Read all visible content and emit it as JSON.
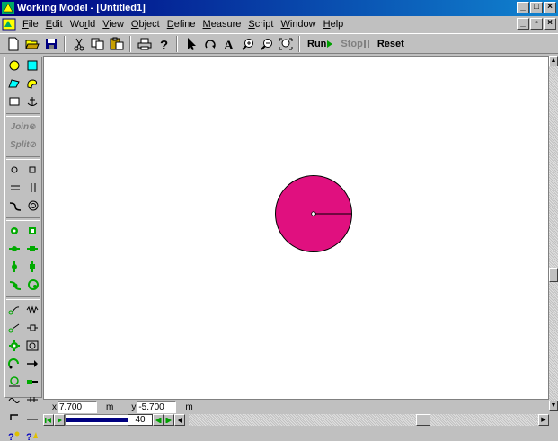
{
  "window": {
    "title": "Working Model - [Untitled1]",
    "minimize_icon": "minimize-icon",
    "maximize_icon": "maximize-icon",
    "close_icon": "close-icon",
    "min_glyph": "_",
    "max_glyph": "□",
    "close_glyph": "×"
  },
  "menubar": {
    "items": [
      {
        "ul": "F",
        "rest": "ile"
      },
      {
        "ul": "E",
        "rest": "dit"
      },
      {
        "pre": "Wo",
        "ul": "r",
        "rest": "ld"
      },
      {
        "ul": "V",
        "rest": "iew"
      },
      {
        "ul": "O",
        "rest": "bject"
      },
      {
        "ul": "D",
        "rest": "efine"
      },
      {
        "ul": "M",
        "rest": "easure"
      },
      {
        "ul": "S",
        "rest": "cript"
      },
      {
        "ul": "W",
        "rest": "indow"
      },
      {
        "ul": "H",
        "rest": "elp"
      }
    ],
    "restore_glyph": "▫"
  },
  "toolbar": {
    "icons": [
      "new-file-icon",
      "open-folder-icon",
      "save-icon",
      "cut-icon",
      "copy-icon",
      "paste-icon",
      "print-icon",
      "help-cursor-icon",
      "pointer-icon",
      "rotate-icon",
      "text-icon",
      "zoom-in-icon",
      "zoom-out-icon",
      "zoom-fit-icon"
    ],
    "run_label": "Run",
    "stop_label": "Stop",
    "reset_label": "Reset"
  },
  "palette": {
    "join_label": "Join",
    "split_label": "Split"
  },
  "canvas": {
    "circle_color": "#e0107f"
  },
  "coords": {
    "x_label": "x",
    "x_value": "7.700",
    "x_unit": "m",
    "y_label": "y",
    "y_value": "-5.700",
    "y_unit": "m"
  },
  "tape": {
    "frame": "40",
    "progress": 1.0
  },
  "colors": {
    "accent": "#000080",
    "body": "#e0107f",
    "run_green": "#00a000"
  }
}
